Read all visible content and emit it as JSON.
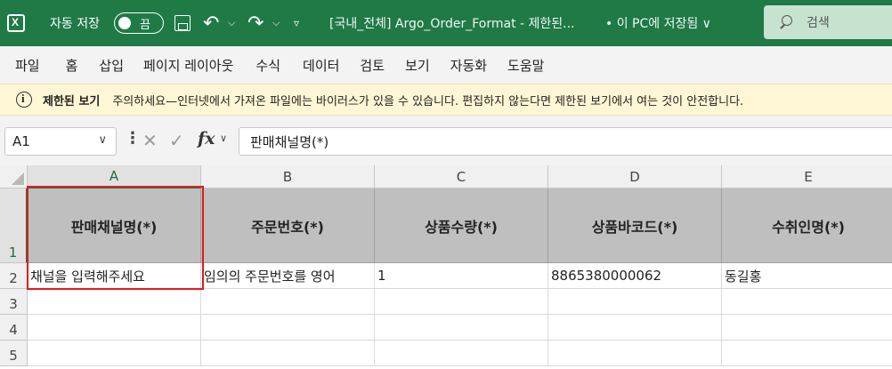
{
  "titlebar": {
    "app_icon": "excel-icon",
    "autosave_label": "자동 저장",
    "autosave_toggle": "끔",
    "save_icon": "save-icon",
    "undo_icon": "undo-icon",
    "redo_icon": "redo-icon",
    "document_title": "[국내_전체] Argo_Order_Format  -  제한된...",
    "save_status": "• 이 PC에 저장됨 ∨",
    "search_label": "검색"
  },
  "menu": [
    "파일",
    "홈",
    "삽입",
    "페이지 레이아웃",
    "수식",
    "데이터",
    "검토",
    "보기",
    "자동화",
    "도움말"
  ],
  "banner": {
    "title": "제한된 보기",
    "message": "주의하세요—인터넷에서 가져온 파일에는 바이러스가 있을 수 있습니다. 편집하지 않는다면 제한된 보기에서 여는 것이 안전합니다."
  },
  "formula_bar": {
    "name_box": "A1",
    "fx_label": "fx",
    "formula": "판매채널명(*)"
  },
  "sheet": {
    "columns": [
      "A",
      "B",
      "C",
      "D",
      "E"
    ],
    "rows": [
      "1",
      "2",
      "3",
      "4",
      "5"
    ],
    "header_row": [
      "판매채널명(*)",
      "주문번호(*)",
      "상품수량(*)",
      "상품바코드(*)",
      "수취인명(*)"
    ],
    "data_row": [
      "채널을 입력해주세요",
      "임의의 주문번호를 영어",
      "1",
      "8865380000062",
      "동길홍"
    ],
    "selected_cell": "A1",
    "header_fill": "#bfbfbf",
    "accent": "#1f7a46",
    "highlight": "#e0191f"
  }
}
